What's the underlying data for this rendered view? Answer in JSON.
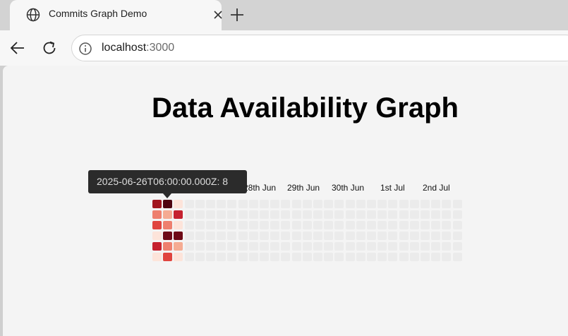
{
  "browser": {
    "tab_title": "Commits Graph Demo",
    "url_host": "localhost",
    "url_port": ":3000"
  },
  "page": {
    "title": "Data Availability Graph"
  },
  "graph": {
    "column_labels": [
      "28th Jun",
      "29th Jun",
      "30th Jun",
      "1st Jul",
      "2nd Jul"
    ],
    "colors": {
      "empty": "#ebebeb",
      "l0": "#fde4da",
      "l1": "#f5ab92",
      "l2": "#ee7f6e",
      "l3": "#e0443f",
      "l4": "#c5212f",
      "l5": "#a1151f",
      "l6": "#6e0a17",
      "l7": "#4f0411"
    },
    "active_columns": [
      [
        "l5",
        "l2",
        "l3",
        "l0",
        "l4",
        "l0"
      ],
      [
        "l7",
        "l1",
        "l2",
        "l6",
        "l2",
        "l3"
      ],
      [
        "l0",
        "l4",
        "l0",
        "l6",
        "l1",
        "l0"
      ]
    ],
    "tooltip": "2025-06-26T06:00:00.000Z: 8"
  }
}
